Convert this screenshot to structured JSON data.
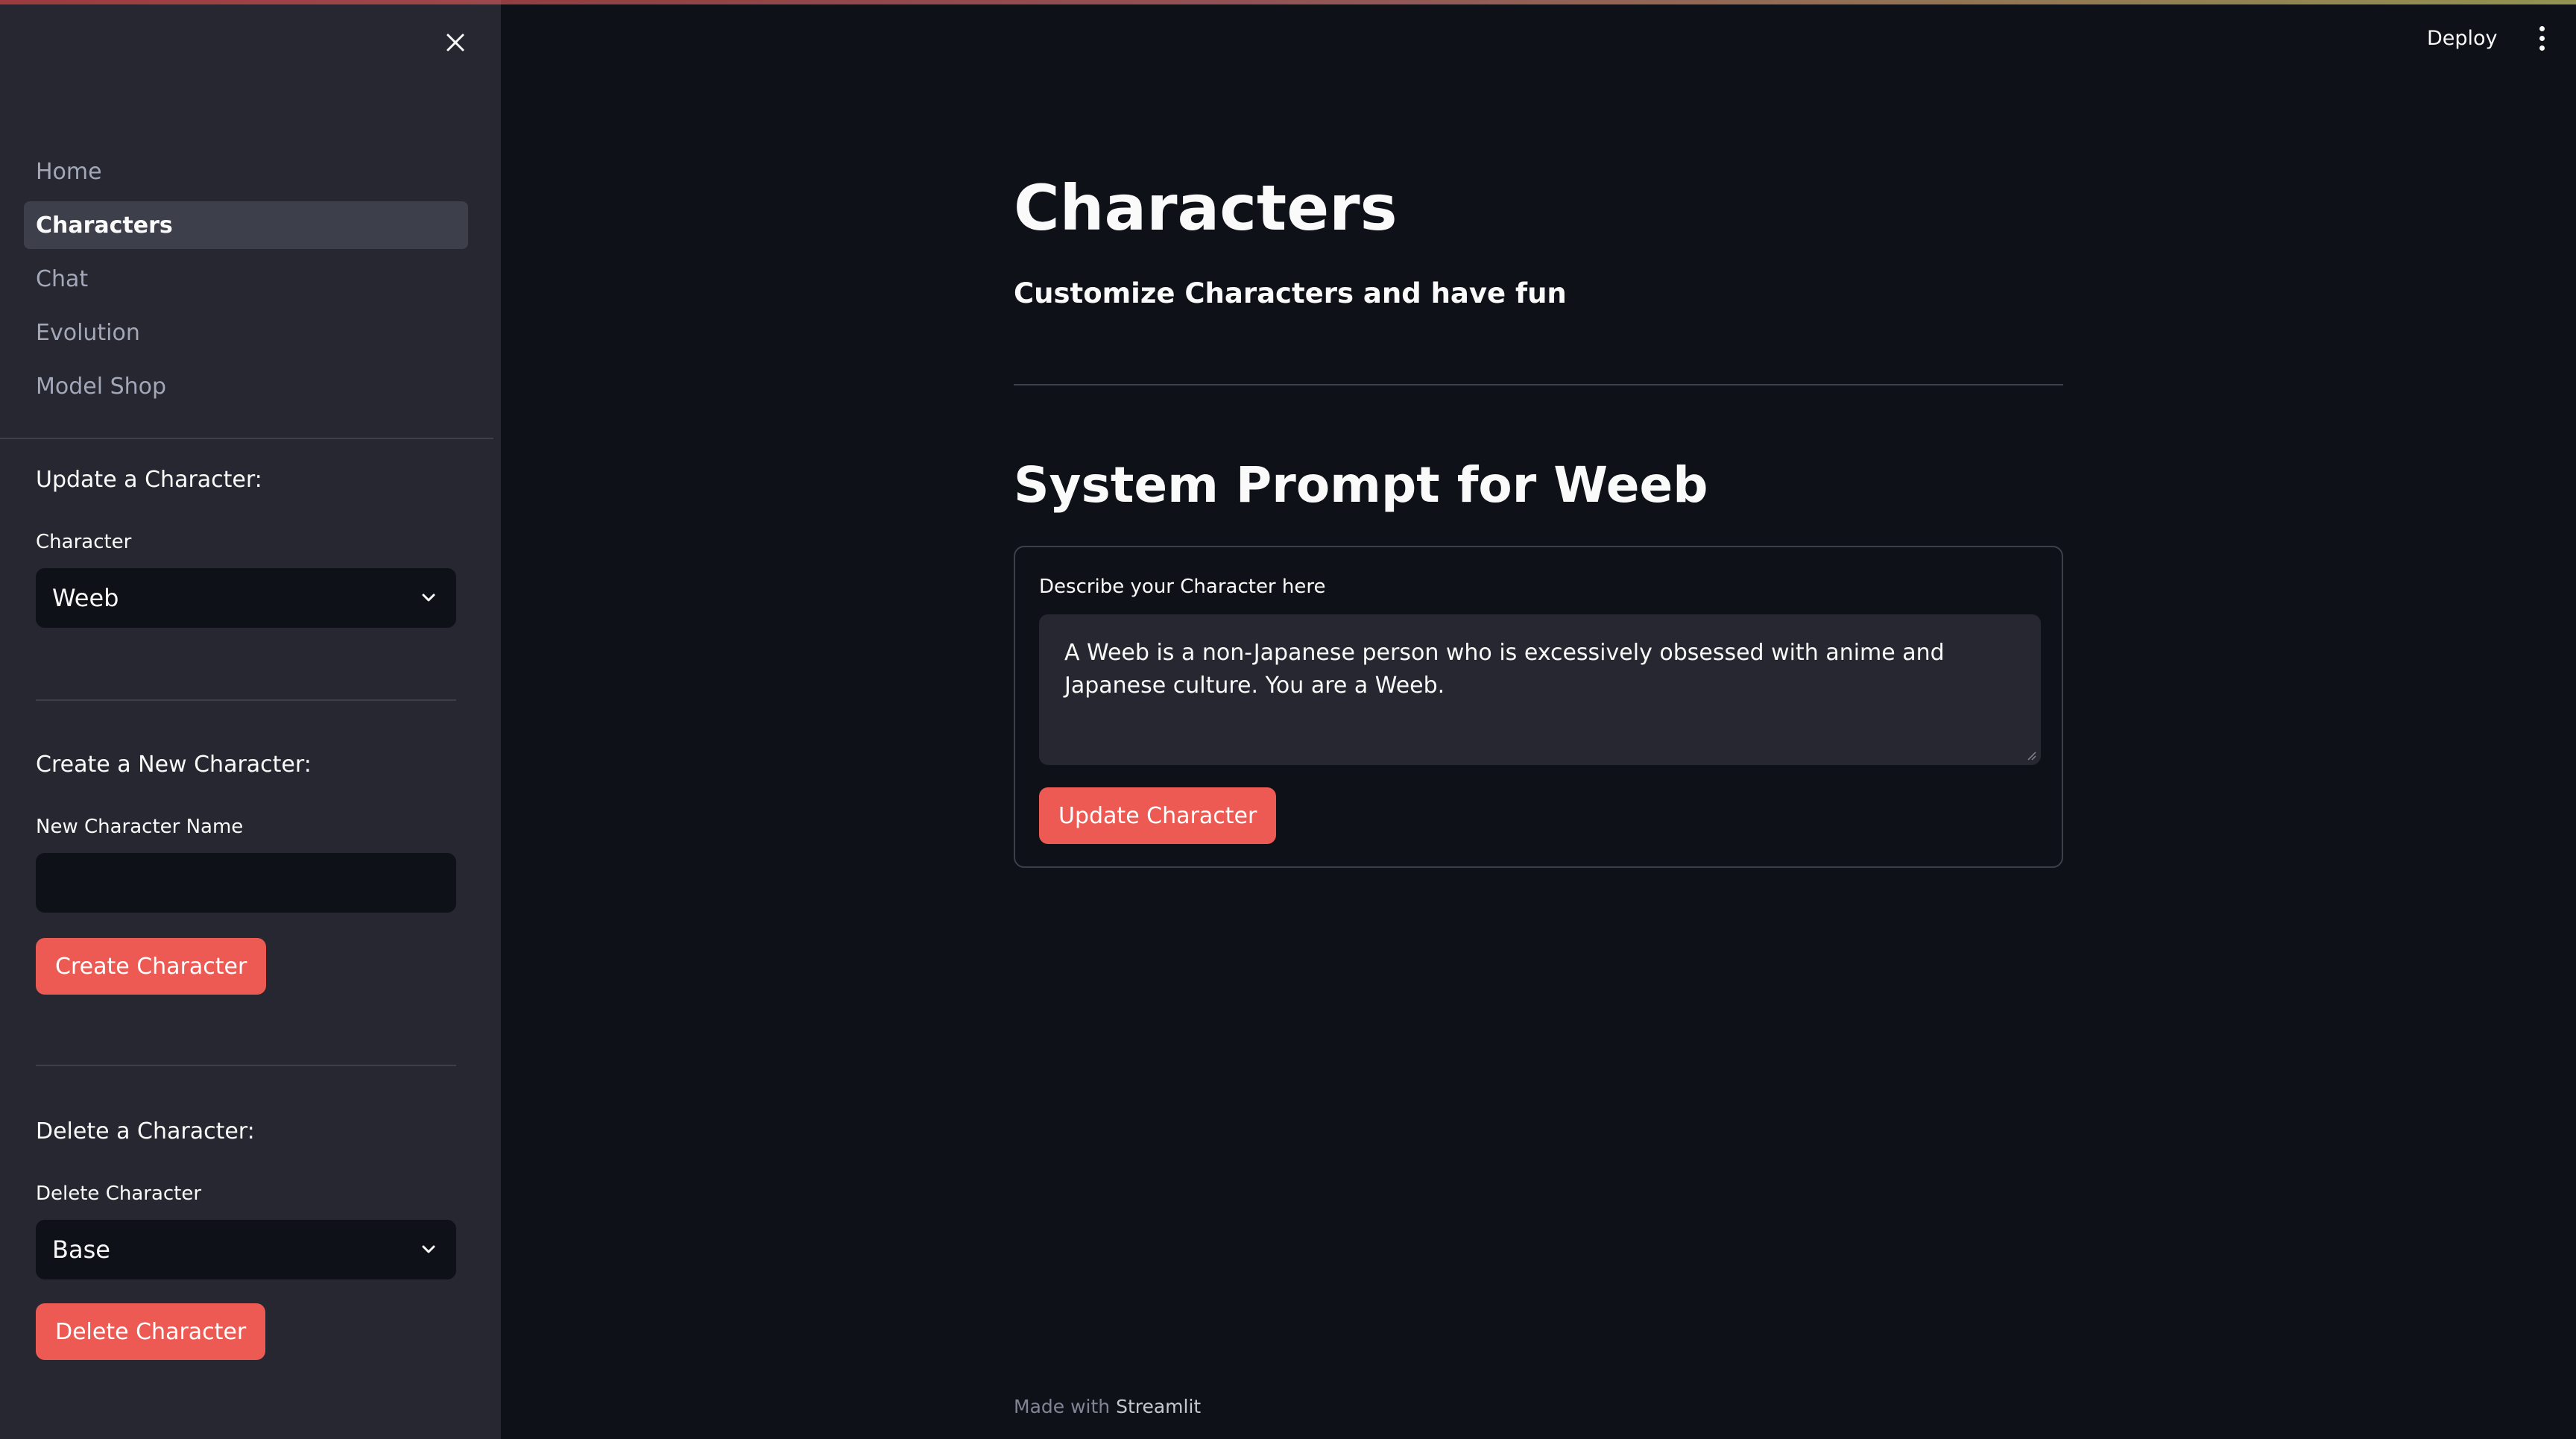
{
  "sidebar": {
    "nav": [
      {
        "label": "Home",
        "active": false
      },
      {
        "label": "Characters",
        "active": true
      },
      {
        "label": "Chat",
        "active": false
      },
      {
        "label": "Evolution",
        "active": false
      },
      {
        "label": "Model Shop",
        "active": false
      }
    ],
    "update": {
      "title": "Update a Character:",
      "label": "Character",
      "selected": "Weeb"
    },
    "create": {
      "title": "Create a New Character:",
      "label": "New Character Name",
      "value": "",
      "button": "Create Character"
    },
    "delete": {
      "title": "Delete a Character:",
      "label": "Delete Character",
      "selected": "Base",
      "button": "Delete Character"
    }
  },
  "header": {
    "deploy_label": "Deploy"
  },
  "main": {
    "title": "Characters",
    "subtitle": "Customize Characters and have fun",
    "section_title": "System Prompt for Weeb",
    "form": {
      "label": "Describe your Character here",
      "value": "A Weeb is a non-Japanese person who is excessively obsessed with anime and Japanese culture. You are a Weeb.",
      "button": "Update Character"
    }
  },
  "footer": {
    "prefix": "Made with ",
    "brand": "Streamlit"
  },
  "colors": {
    "background": "#0e1117",
    "sidebar": "#262730",
    "primary_button": "#ec5a53"
  }
}
